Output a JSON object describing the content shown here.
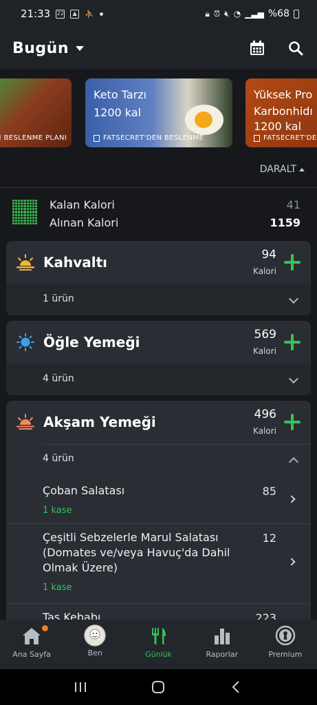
{
  "status_bar": {
    "time": "21:33",
    "battery": "%68",
    "calendar_day": "22"
  },
  "appbar": {
    "title": "Bugün",
    "icons": [
      "calendar-icon",
      "search-icon"
    ]
  },
  "banners": [
    {
      "title": "",
      "calories": "",
      "source": "N BESLENME PLANI"
    },
    {
      "title": "Keto Tarzı",
      "calories": "1200 kal",
      "source": "FATSECRET'DEN BESLENME"
    },
    {
      "title": "Yüksek Pro Karbonhidı",
      "calories": "1200 kal",
      "source": "FATSECRET'DEN"
    }
  ],
  "collapse_label": "DARALT",
  "summary": {
    "remaining_label": "Kalan Kalori",
    "remaining_value": "41",
    "consumed_label": "Alınan Kalori",
    "consumed_value": "1159"
  },
  "meals": [
    {
      "title": "Kahvaltı",
      "calories": "94",
      "unit": "Kalori",
      "count": "1 ürün"
    },
    {
      "title": "Öğle Yemeği",
      "calories": "569",
      "unit": "Kalori",
      "count": "4 ürün"
    },
    {
      "title": "Akşam Yemeği",
      "calories": "496",
      "unit": "Kalori",
      "count": "4 ürün",
      "items": [
        {
          "name": "Çoban Salatası",
          "qty": "1 kase",
          "calories": "85"
        },
        {
          "name": "Çeşitli Sebzelerle Marul Salatası (Domates ve/veya Havuç'da Dahil Olmak Üzere)",
          "qty": "1 kase",
          "calories": "12"
        },
        {
          "name": "Tas Kebabı",
          "qty": "",
          "calories": "223"
        }
      ]
    }
  ],
  "bottom_nav": [
    {
      "label": "Ana Sayfa",
      "icon": "home-icon"
    },
    {
      "label": "Ben",
      "icon": "avatar-icon"
    },
    {
      "label": "Günlük",
      "icon": "fork-knife-icon"
    },
    {
      "label": "Raporlar",
      "icon": "bar-chart-icon"
    },
    {
      "label": "Premium",
      "icon": "premium-icon"
    }
  ],
  "colors": {
    "accent": "#35c258",
    "background": "#16181c",
    "card": "#2a2d33",
    "badge": "#ef7d22"
  }
}
